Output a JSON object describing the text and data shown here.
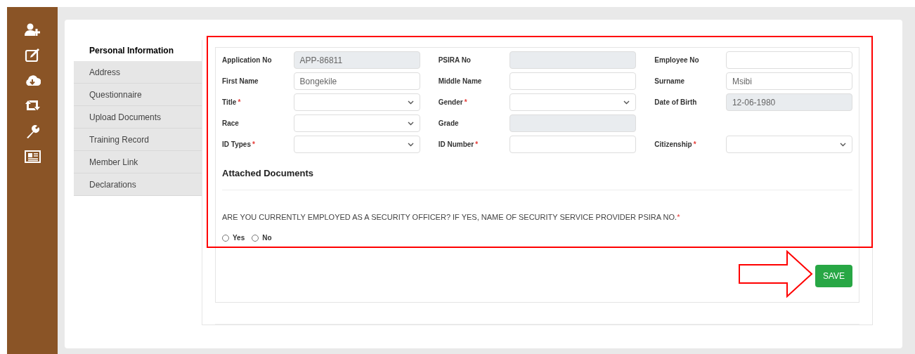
{
  "tabs": [
    {
      "label": "Personal Information",
      "selected": true
    },
    {
      "label": "Address",
      "selected": false
    },
    {
      "label": "Questionnaire",
      "selected": false
    },
    {
      "label": "Upload Documents",
      "selected": false
    },
    {
      "label": "Training Record",
      "selected": false
    },
    {
      "label": "Member Link",
      "selected": false
    },
    {
      "label": "Declarations",
      "selected": false
    }
  ],
  "form": {
    "rows": [
      [
        {
          "label": "Application No",
          "kind": "text",
          "value": "APP-86811",
          "disabled": true
        },
        {
          "label": "PSIRA No",
          "kind": "text",
          "disabled": true
        },
        {
          "label": "Employee No",
          "kind": "text",
          "disabled": false
        }
      ],
      [
        {
          "label": "First Name",
          "kind": "text",
          "value": "Bongekile",
          "disabled": false
        },
        {
          "label": "Middle Name",
          "kind": "text",
          "disabled": false
        },
        {
          "label": "Surname",
          "kind": "text",
          "value": "Msibi",
          "disabled": false
        }
      ],
      [
        {
          "label": "Title",
          "required": "*",
          "kind": "select",
          "disabled": false
        },
        {
          "label": "Gender",
          "required": "*",
          "kind": "select",
          "disabled": false
        },
        {
          "label": "Date of Birth",
          "kind": "text",
          "value": "12-06-1980",
          "disabled": true
        }
      ],
      [
        {
          "label": "Race",
          "kind": "select",
          "disabled": false
        },
        {
          "label": "Grade",
          "kind": "text",
          "disabled": true
        }
      ],
      [
        {
          "label": "ID Types",
          "required": "*",
          "kind": "select",
          "disabled": false
        },
        {
          "label": "ID Number",
          "required": "*",
          "kind": "text",
          "disabled": false
        },
        {
          "label": "Citizenship",
          "required": "*",
          "kind": "select",
          "disabled": false
        }
      ]
    ],
    "section_title": "Attached Documents",
    "question": {
      "text": "ARE YOU CURRENTLY EMPLOYED AS A SECURITY OFFICER? IF YES, NAME OF SECURITY SERVICE PROVIDER PSIRA NO.",
      "required": "*",
      "options": [
        {
          "label": "Yes",
          "selected": false
        },
        {
          "label": "No",
          "selected": false
        }
      ]
    }
  },
  "save_button": "SAVE"
}
